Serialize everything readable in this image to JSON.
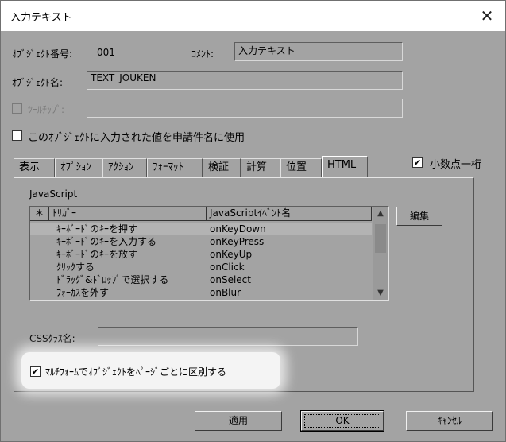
{
  "window": {
    "title": "入力テキスト",
    "close_glyph": "✕"
  },
  "object_number": {
    "label": "ｵﾌﾞｼﾞｪｸﾄ番号:",
    "value": "001"
  },
  "comment": {
    "label": "ｺﾒﾝﾄ:",
    "value": "入力テキスト"
  },
  "object_name": {
    "label": "ｵﾌﾞｼﾞｪｸﾄ名:",
    "value": "TEXT_JOUKEN"
  },
  "tooltip": {
    "label": "ﾂｰﾙﾁｯﾌﾟ:",
    "checked": false,
    "value": ""
  },
  "use_for_title": {
    "label": "このｵﾌﾞｼﾞｪｸﾄに入力された値を申請件名に使用",
    "checked": false
  },
  "decimal_digit": {
    "label": "小数点一桁",
    "checked": true,
    "check_glyph": "✔"
  },
  "tabs": [
    {
      "label": "表示"
    },
    {
      "label": "ｵﾌﾟｼｮﾝ"
    },
    {
      "label": "ｱｸｼｮﾝ"
    },
    {
      "label": "ﾌｫｰﾏｯﾄ"
    },
    {
      "label": "検証"
    },
    {
      "label": "計算"
    },
    {
      "label": "位置"
    },
    {
      "label": "HTML"
    }
  ],
  "active_tab": "HTML",
  "javascript": {
    "label": "JavaScript",
    "columns": [
      "＊",
      "ﾄﾘｶﾞｰ",
      "JavaScriptｲﾍﾞﾝﾄ名"
    ],
    "rows": [
      {
        "trigger": "ｷｰﾎﾞｰﾄﾞのｷｰを押す",
        "event": "onKeyDown"
      },
      {
        "trigger": "ｷｰﾎﾞｰﾄﾞのｷｰを入力する",
        "event": "onKeyPress"
      },
      {
        "trigger": "ｷｰﾎﾞｰﾄﾞのｷｰを放す",
        "event": "onKeyUp"
      },
      {
        "trigger": "ｸﾘｯｸする",
        "event": "onClick"
      },
      {
        "trigger": "ﾄﾞﾗｯｸﾞ&ﾄﾞﾛｯﾌﾟで選択する",
        "event": "onSelect"
      },
      {
        "trigger": "ﾌｫｰｶｽを外す",
        "event": "onBlur"
      }
    ],
    "scroll_up": "▲",
    "scroll_down": "▼",
    "edit_button": "編集"
  },
  "css_class": {
    "label": "CSSｸﾗｽ名:",
    "value": ""
  },
  "multiform": {
    "label": "ﾏﾙﾁﾌｫｰﾑでｵﾌﾞｼﾞｪｸﾄをﾍﾟｰｼﾞごとに区別する",
    "checked": true,
    "check_glyph": "✔"
  },
  "buttons": {
    "apply": "適用",
    "ok": "OK",
    "cancel": "ｷｬﾝｾﾙ"
  }
}
